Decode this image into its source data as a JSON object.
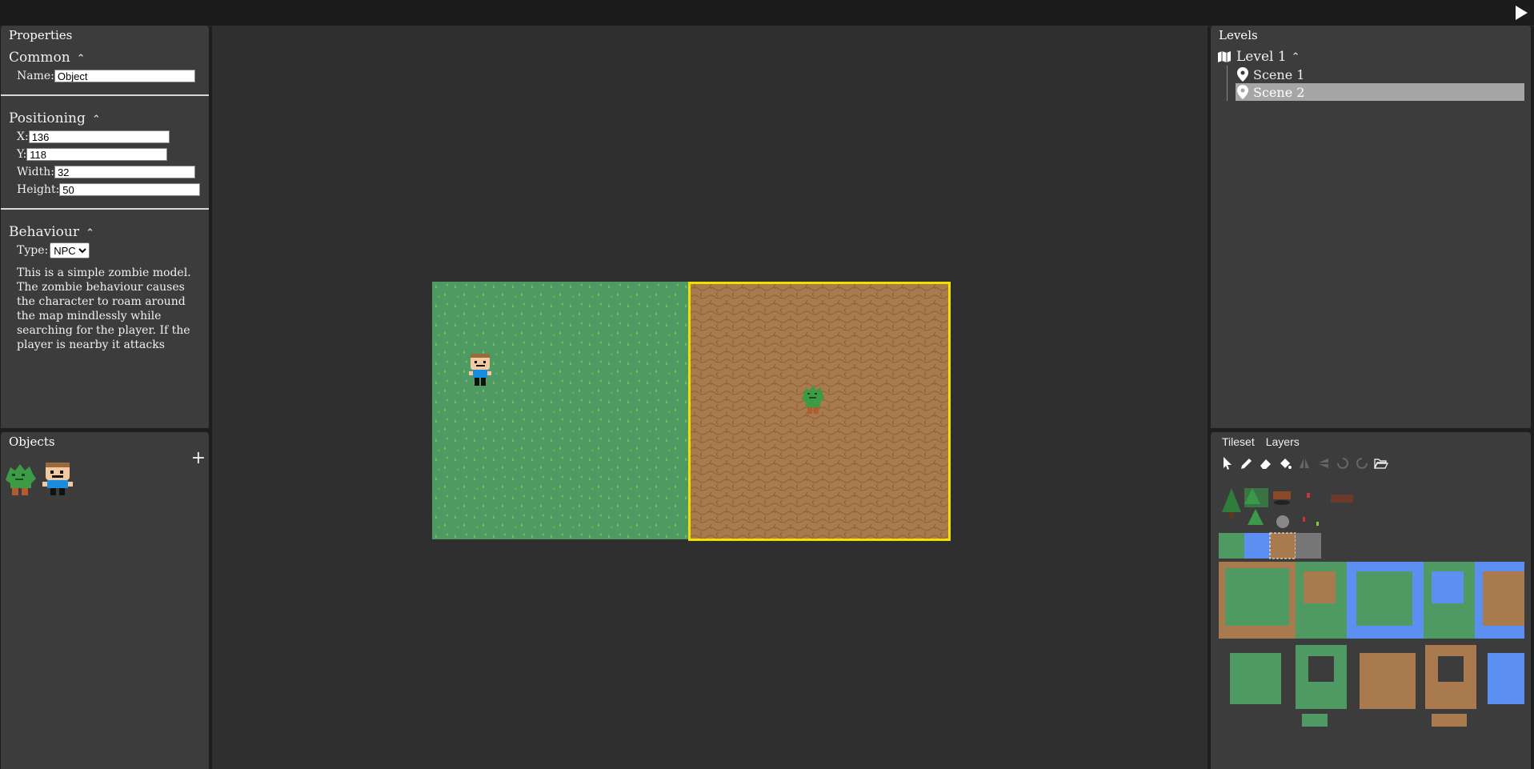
{
  "properties": {
    "title": "Properties",
    "common": {
      "header": "Common",
      "caret": "⌃",
      "name_label": "Name:",
      "name_value": "Object"
    },
    "positioning": {
      "header": "Positioning",
      "caret": "⌃",
      "x_label": "X:",
      "x_value": "136",
      "y_label": "Y:",
      "y_value": "118",
      "width_label": "Width:",
      "width_value": "32",
      "height_label": "Height:",
      "height_value": "50"
    },
    "behaviour": {
      "header": "Behaviour",
      "caret": "⌃",
      "type_label": "Type:",
      "type_value": "NPC",
      "description": "This is a simple zombie model. The zombie behaviour causes the character to roam around the map mindlessly while searching for the player. If the player is nearby it attacks"
    }
  },
  "objects": {
    "title": "Objects",
    "add_label": "+",
    "items": [
      "zombie-object",
      "player-object"
    ]
  },
  "levels": {
    "title": "Levels",
    "level": {
      "label": "Level 1",
      "caret": "⌃"
    },
    "scenes": [
      {
        "label": "Scene 1",
        "selected": false
      },
      {
        "label": "Scene 2",
        "selected": true
      }
    ]
  },
  "tileset": {
    "tabs": [
      "Tileset",
      "Layers"
    ],
    "tools": [
      "pointer-icon",
      "pencil-icon",
      "eraser-icon",
      "fill-icon",
      "flip-horizontal-icon",
      "flip-vertical-icon",
      "rotate-left-icon",
      "rotate-right-icon",
      "folder-open-icon"
    ]
  },
  "colors": {
    "grass": "#4e9a62",
    "dirt": "#a97a4e",
    "water": "#5b8ff2",
    "selection": "#f0e000",
    "panel": "#3c3c3c",
    "canvas": "#2f2f2f"
  }
}
